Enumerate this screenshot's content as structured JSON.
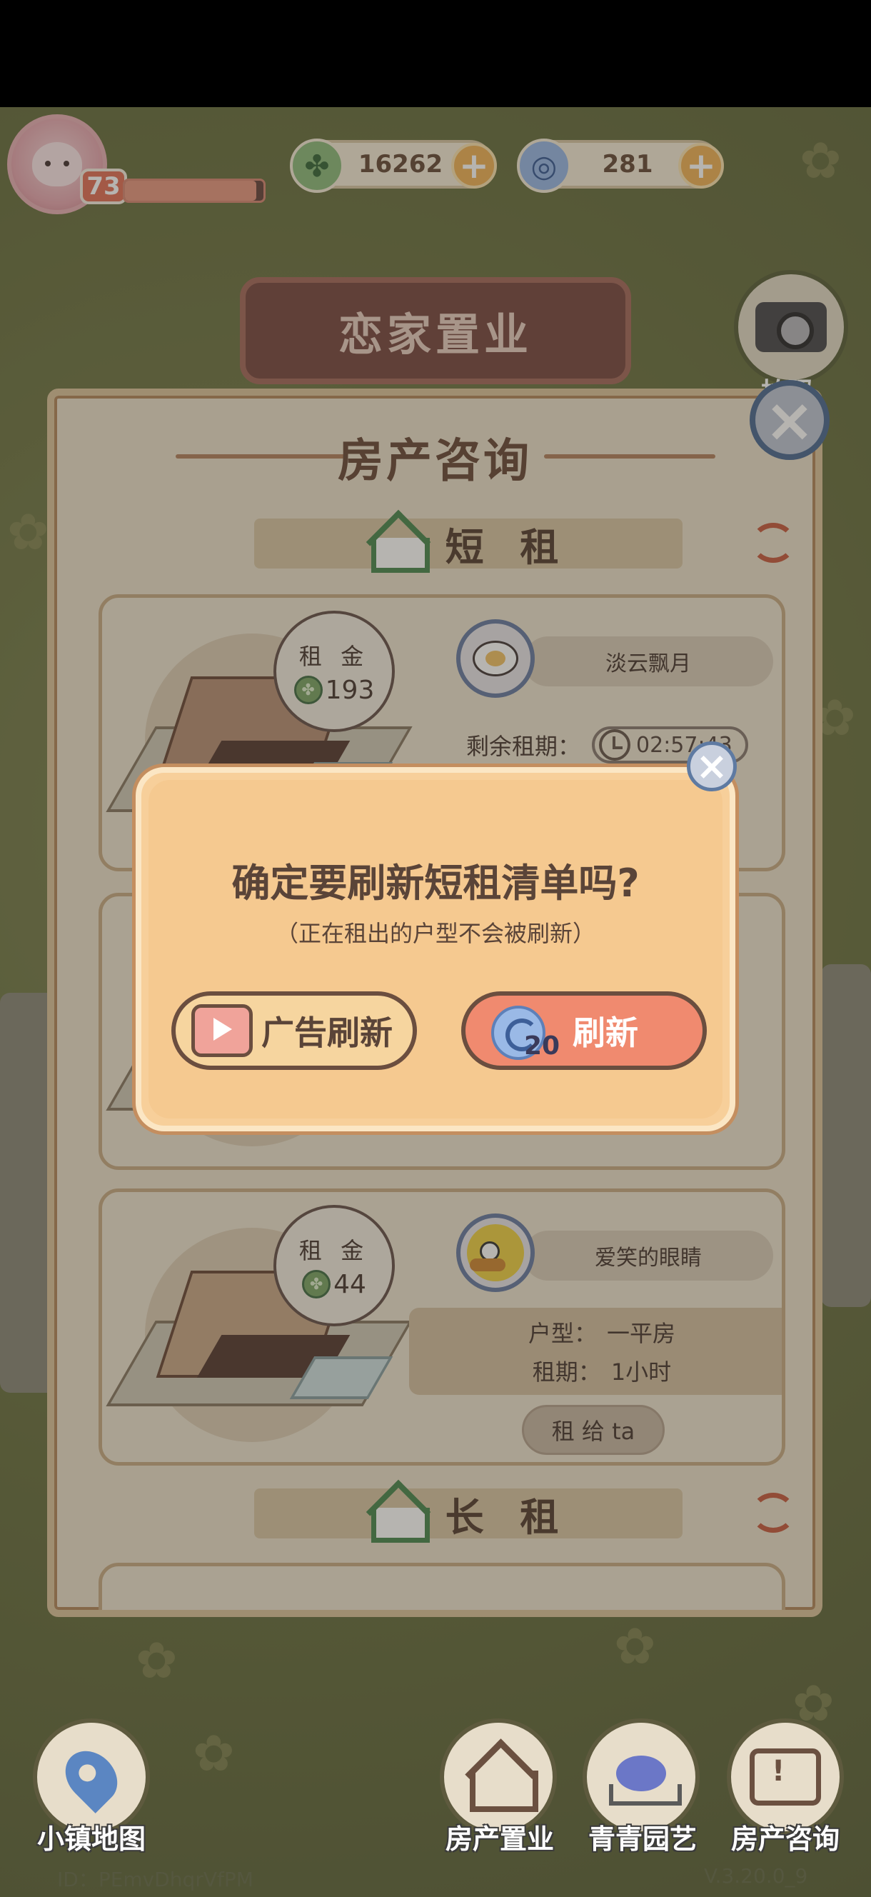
{
  "hud": {
    "level": "73",
    "xp_fraction": 0.95,
    "clover_amount": "16262",
    "gem_amount": "281",
    "camera_label": "拍照"
  },
  "sign": {
    "title": "恋家置业"
  },
  "panel": {
    "title": "房产咨询",
    "short_rent_label": "短 租",
    "long_rent_label": "长 租"
  },
  "listings": [
    {
      "rent_label": "租 金",
      "rent_value": "193",
      "tenant": "淡云飘月",
      "lease_label": "剩余租期：",
      "timer": "02:57:43"
    },
    {
      "rent_label": "租 金",
      "rent_value": "44",
      "tenant": "爱笑的眼睛",
      "type_label": "户型：",
      "type_value": "一平房",
      "term_label": "租期：",
      "term_value": "1小时",
      "button": "租 给 ta"
    }
  ],
  "dialog": {
    "title": "确定要刷新短租清单吗?",
    "subtitle": "（正在租出的户型不会被刷新）",
    "ad_button": "广告刷新",
    "refresh_button": "刷新",
    "refresh_cost": "20"
  },
  "nav": {
    "map": "小镇地图",
    "property": "房产置业",
    "garden": "青青园艺",
    "consult": "房产咨询"
  },
  "footer": {
    "id": "ID：PEmvDhqrVfPM",
    "version": "V.3.20.0_9"
  },
  "colors": {
    "panel_bg": "#ebe1cd",
    "dialog_bg": "#f5c990",
    "refresh_btn": "#f08a6f",
    "accent_green": "#4f8a55"
  }
}
